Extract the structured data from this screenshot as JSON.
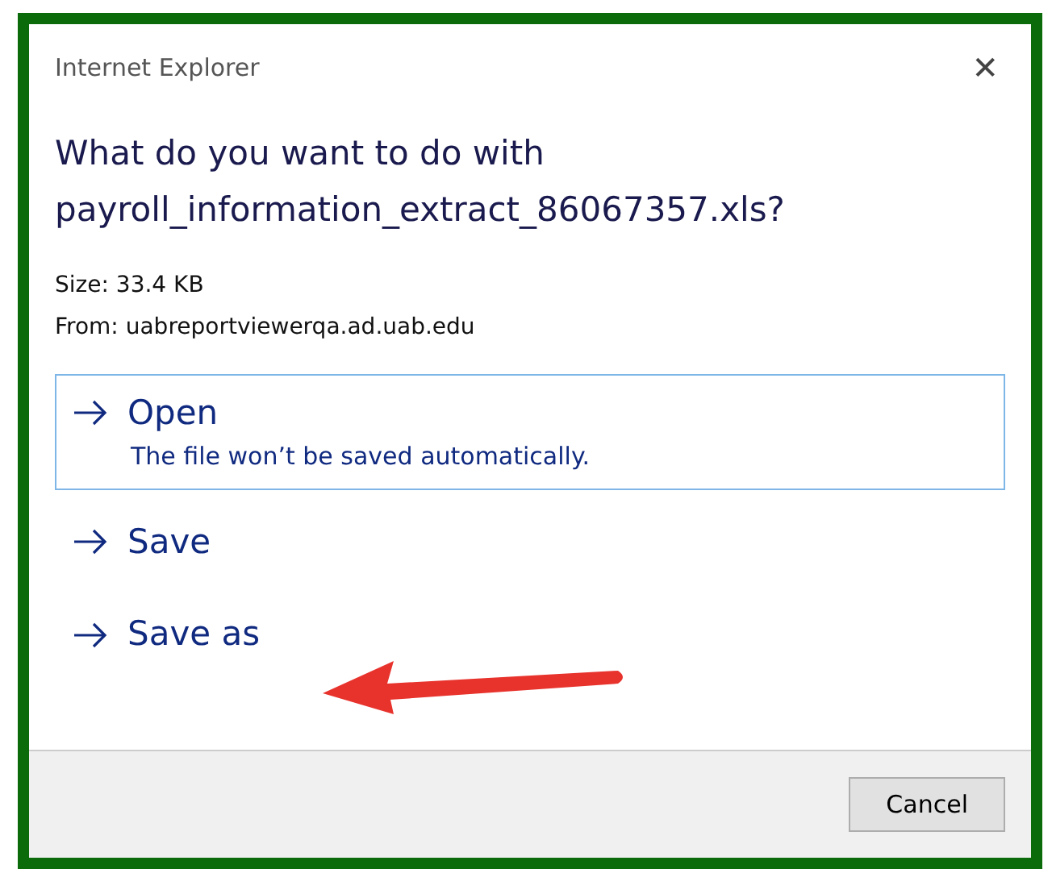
{
  "window": {
    "title": "Internet Explorer",
    "close_glyph": "✕"
  },
  "question": "What do you want to do with payroll_information_extract_86067357.xls?",
  "details": [
    "Size: 33.4 KB",
    "From: uabreportviewerqa.ad.uab.edu"
  ],
  "options": [
    {
      "label": "Open",
      "description": "The file won’t be saved automatically.",
      "selected": true
    },
    {
      "label": "Save",
      "selected": false
    },
    {
      "label": "Save as",
      "selected": false
    }
  ],
  "buttons": [
    "Cancel"
  ]
}
